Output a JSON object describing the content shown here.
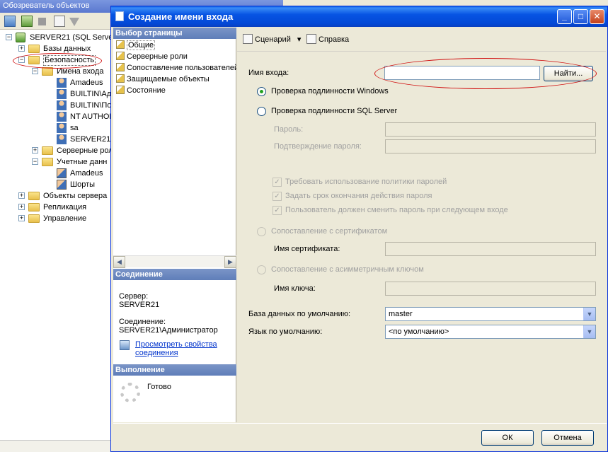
{
  "explorer": {
    "title": "Обозреватель объектов",
    "tree": [
      {
        "label": "SERVER21 (SQL Server",
        "level": 0,
        "expander": "−",
        "icon": "server-icon"
      },
      {
        "label": "Базы данных",
        "level": 1,
        "expander": "+",
        "icon": "folder-icon"
      },
      {
        "label": "Безопасность",
        "level": 1,
        "expander": "−",
        "icon": "folder-icon"
      },
      {
        "label": "Имена входа",
        "level": 2,
        "expander": "−",
        "icon": "folder-icon"
      },
      {
        "label": "Amadeus",
        "level": 3,
        "expander": "",
        "icon": "user-icon"
      },
      {
        "label": "BUILTIN\\Ад",
        "level": 3,
        "expander": "",
        "icon": "group-icon"
      },
      {
        "label": "BUILTIN\\По",
        "level": 3,
        "expander": "",
        "icon": "group-icon"
      },
      {
        "label": "NT AUTHOR",
        "level": 3,
        "expander": "",
        "icon": "group-icon"
      },
      {
        "label": "sa",
        "level": 3,
        "expander": "",
        "icon": "user-disabled-icon"
      },
      {
        "label": "SERVER21\\",
        "level": 3,
        "expander": "",
        "icon": "user-icon"
      },
      {
        "label": "Серверные рол",
        "level": 2,
        "expander": "+",
        "icon": "folder-icon"
      },
      {
        "label": "Учетные данн",
        "level": 2,
        "expander": "−",
        "icon": "folder-icon"
      },
      {
        "label": "Amadeus",
        "level": 3,
        "expander": "",
        "icon": "credential-icon"
      },
      {
        "label": "Шорты",
        "level": 3,
        "expander": "",
        "icon": "credential-icon"
      },
      {
        "label": "Объекты сервера",
        "level": 1,
        "expander": "+",
        "icon": "folder-icon"
      },
      {
        "label": "Репликация",
        "level": 1,
        "expander": "+",
        "icon": "folder-icon"
      },
      {
        "label": "Управление",
        "level": 1,
        "expander": "+",
        "icon": "folder-icon"
      }
    ]
  },
  "dialog": {
    "title": "Создание имени входа",
    "caption_buttons": {
      "minimize": "_",
      "maximize": "□",
      "close": "✕"
    },
    "left": {
      "select_page_header": "Выбор страницы",
      "pages": [
        "Общие",
        "Серверные роли",
        "Сопоставление пользователей",
        "Защищаемые объекты",
        "Состояние"
      ],
      "connection_header": "Соединение",
      "server_label": "Сервер:",
      "server_value": "SERVER21",
      "connection_label": "Соединение:",
      "connection_value": "SERVER21\\Администратор",
      "view_props_line1": "Просмотреть свойства",
      "view_props_line2": "соединения",
      "progress_header": "Выполнение",
      "progress_status": "Готово"
    },
    "toolbar": {
      "script": "Сценарий",
      "script_arrow": "▾",
      "help": "Справка"
    },
    "form": {
      "login_name_label": "Имя входа:",
      "login_name_value": "",
      "find_button": "Найти...",
      "windows_auth": "Проверка подлинности Windows",
      "sql_auth": "Проверка подлинности SQL Server",
      "password_label": "Пароль:",
      "confirm_password_label": "Подтверждение пароля:",
      "enforce_policy": "Требовать использование политики паролей",
      "enforce_expiration": "Задать срок окончания действия пароля",
      "must_change": "Пользователь должен сменить пароль при следующем входе",
      "map_certificate": "Сопоставление с сертификатом",
      "certificate_name_label": "Имя сертификата:",
      "map_asym_key": "Сопоставление с асимметричным ключом",
      "key_name_label": "Имя ключа:",
      "default_db_label": "База данных по умолчанию:",
      "default_db_value": "master",
      "default_lang_label": "Язык по умолчанию:",
      "default_lang_value": "<по умолчанию>",
      "check_mark": "✓"
    },
    "buttons": {
      "ok": "ОК",
      "cancel": "Отмена"
    }
  }
}
